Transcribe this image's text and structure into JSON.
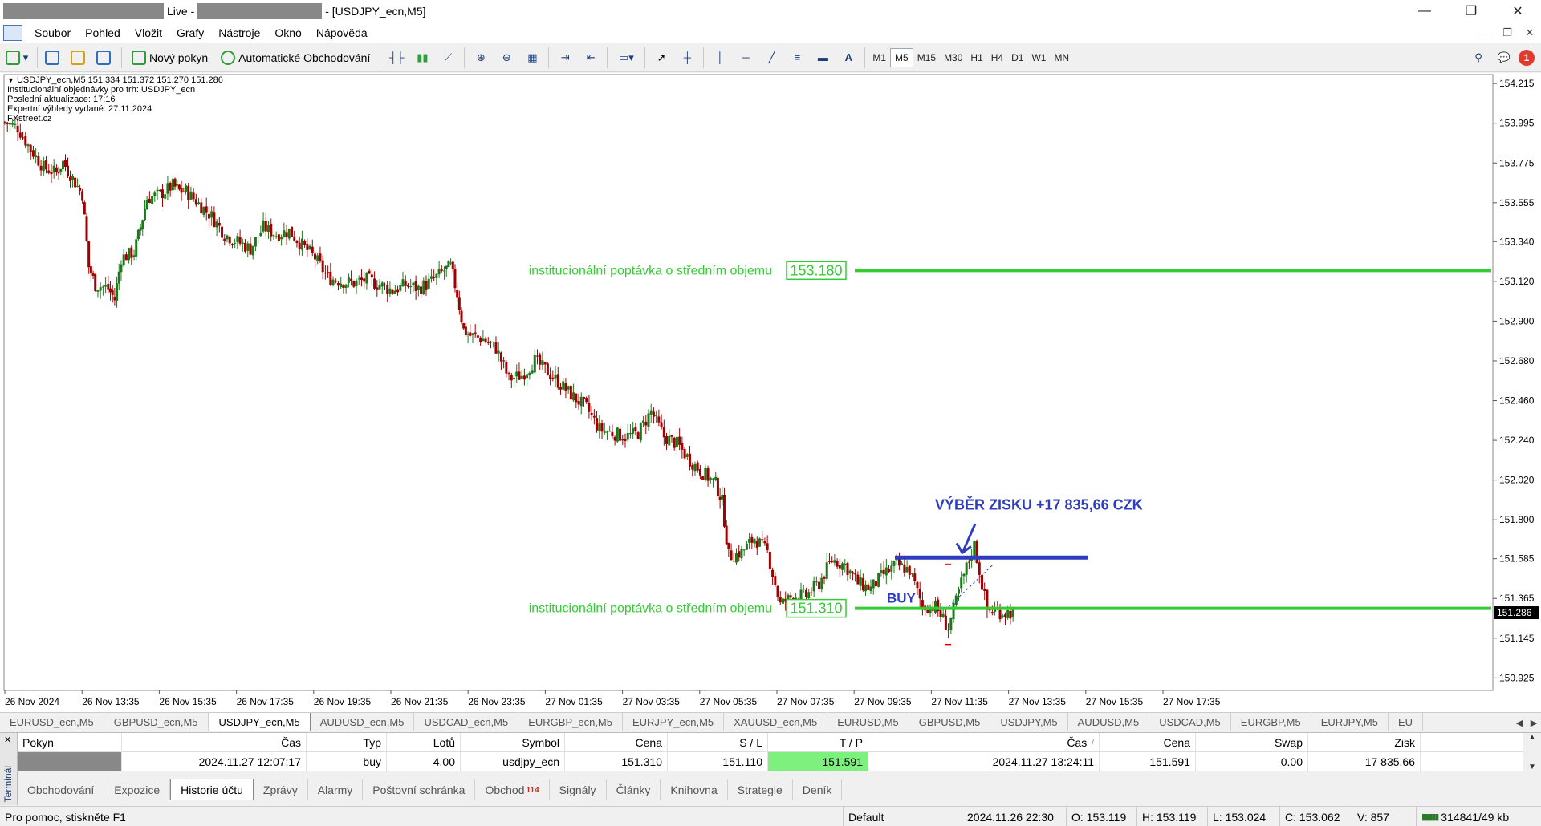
{
  "title": {
    "live": "Live -",
    "tail": "- [USDJPY_ecn,M5]"
  },
  "window_controls": {
    "min": "—",
    "max": "❐",
    "close": "✕"
  },
  "menu": [
    "Soubor",
    "Pohled",
    "Vložit",
    "Grafy",
    "Nástroje",
    "Okno",
    "Nápověda"
  ],
  "toolbar": {
    "new_order": "Nový pokyn",
    "auto_trading": "Automatické Obchodování",
    "timeframes": [
      "M1",
      "M5",
      "M15",
      "M30",
      "H1",
      "H4",
      "D1",
      "W1",
      "MN"
    ],
    "active_timeframe": "M5",
    "notification_count": "1"
  },
  "chart": {
    "header_line": "USDJPY_ecn,M5  151.334 151.372 151.270 151.286",
    "info_lines": [
      "Institucionální objednávky pro trh: USDJPY_ecn",
      "Poslední aktualizace: 17:16",
      "Expertní výhledy vydané: 27.11.2024",
      "FXstreet.cz"
    ],
    "level_label_upper": "institucionální poptávka o středním objemu",
    "level_value_upper": "153.180",
    "level_label_lower": "institucionální poptávka o středním objemu",
    "level_value_lower": "151.310",
    "annotation_profit": "VÝBĚR ZISKU +17 835,66 CZK",
    "annotation_buy": "BUY",
    "current_price": "151.286",
    "colors": {
      "level": "#33cc33",
      "annotation": "#2e3dbf",
      "bull": "#1a7a1a",
      "bear": "#a00000",
      "tp_cell": "#7ef07e"
    }
  },
  "chart_data": {
    "type": "candlestick",
    "title": "",
    "symbol": "USDJPY_ecn",
    "timeframe": "M5",
    "x_tick_labels": [
      "26 Nov 2024",
      "26 Nov 13:35",
      "26 Nov 15:35",
      "26 Nov 17:35",
      "26 Nov 19:35",
      "26 Nov 21:35",
      "26 Nov 23:35",
      "27 Nov 01:35",
      "27 Nov 03:35",
      "27 Nov 05:35",
      "27 Nov 07:35",
      "27 Nov 09:35",
      "27 Nov 11:35",
      "27 Nov 13:35",
      "27 Nov 15:35",
      "27 Nov 17:35"
    ],
    "y_tick_labels": [
      "154.215",
      "153.995",
      "153.775",
      "153.555",
      "153.340",
      "153.120",
      "152.900",
      "152.680",
      "152.460",
      "152.240",
      "152.020",
      "151.800",
      "151.585",
      "151.365",
      "151.145",
      "150.925"
    ],
    "ylim": [
      150.86,
      154.26
    ],
    "price_path": [
      [
        0,
        154.0
      ],
      [
        2,
        153.97
      ],
      [
        4,
        153.85
      ],
      [
        6,
        153.75
      ],
      [
        8,
        153.72
      ],
      [
        9,
        153.78
      ],
      [
        12,
        153.6
      ],
      [
        13,
        153.2
      ],
      [
        14,
        153.1
      ],
      [
        16,
        153.08
      ],
      [
        17,
        153.02
      ],
      [
        18,
        153.25
      ],
      [
        20,
        153.28
      ],
      [
        21,
        153.42
      ],
      [
        22,
        153.58
      ],
      [
        24,
        153.6
      ],
      [
        26,
        153.65
      ],
      [
        27,
        153.62
      ],
      [
        28,
        153.62
      ],
      [
        30,
        153.55
      ],
      [
        32,
        153.48
      ],
      [
        34,
        153.38
      ],
      [
        36,
        153.34
      ],
      [
        38,
        153.3
      ],
      [
        40,
        153.42
      ],
      [
        42,
        153.38
      ],
      [
        44,
        153.4
      ],
      [
        46,
        153.32
      ],
      [
        48,
        153.25
      ],
      [
        50,
        153.14
      ],
      [
        52,
        153.12
      ],
      [
        54,
        153.11
      ],
      [
        56,
        153.13
      ],
      [
        58,
        153.1
      ],
      [
        60,
        153.07
      ],
      [
        62,
        153.1
      ],
      [
        64,
        153.08
      ],
      [
        66,
        153.12
      ],
      [
        68,
        153.18
      ],
      [
        69,
        153.2
      ],
      [
        70,
        153.05
      ],
      [
        71,
        152.85
      ],
      [
        72,
        152.82
      ],
      [
        74,
        152.8
      ],
      [
        76,
        152.75
      ],
      [
        78,
        152.58
      ],
      [
        80,
        152.6
      ],
      [
        82,
        152.68
      ],
      [
        84,
        152.62
      ],
      [
        86,
        152.55
      ],
      [
        88,
        152.48
      ],
      [
        90,
        152.42
      ],
      [
        92,
        152.3
      ],
      [
        94,
        152.28
      ],
      [
        96,
        152.26
      ],
      [
        98,
        152.28
      ],
      [
        100,
        152.4
      ],
      [
        102,
        152.26
      ],
      [
        104,
        152.22
      ],
      [
        106,
        152.13
      ],
      [
        108,
        152.06
      ],
      [
        110,
        152.0
      ],
      [
        111,
        151.9
      ],
      [
        112,
        151.6
      ],
      [
        114,
        151.62
      ],
      [
        116,
        151.7
      ],
      [
        118,
        151.62
      ],
      [
        120,
        151.33
      ],
      [
        122,
        151.38
      ],
      [
        124,
        151.38
      ],
      [
        126,
        151.45
      ],
      [
        128,
        151.58
      ],
      [
        130,
        151.55
      ],
      [
        132,
        151.45
      ],
      [
        134,
        151.42
      ],
      [
        136,
        151.5
      ],
      [
        138,
        151.55
      ],
      [
        140,
        151.52
      ],
      [
        142,
        151.32
      ],
      [
        144,
        151.32
      ],
      [
        146,
        151.2
      ],
      [
        148,
        151.45
      ],
      [
        150,
        151.66
      ],
      [
        152,
        151.3
      ],
      [
        154,
        151.29
      ],
      [
        156,
        151.286
      ]
    ],
    "levels": [
      {
        "label": "institucionální poptávka o středním objemu",
        "price": 153.18
      },
      {
        "label": "institucionální poptávka o středním objemu",
        "price": 151.31
      },
      {
        "label": "VÝBĚR ZISKU +17 835,66 CZK",
        "price": 151.591
      },
      {
        "label": "BUY",
        "price": 151.31
      }
    ],
    "last_price": 151.286,
    "grid": false
  },
  "chart_tabs": [
    "EURUSD_ecn,M5",
    "GBPUSD_ecn,M5",
    "USDJPY_ecn,M5",
    "AUDUSD_ecn,M5",
    "USDCAD_ecn,M5",
    "EURGBP_ecn,M5",
    "EURJPY_ecn,M5",
    "XAUUSD_ecn,M5",
    "EURUSD,M5",
    "GBPUSD,M5",
    "USDJPY,M5",
    "AUDUSD,M5",
    "USDCAD,M5",
    "EURGBP,M5",
    "EURJPY,M5",
    "EU"
  ],
  "active_chart_tab": "USDJPY_ecn,M5",
  "terminal": {
    "side_label": "Terminál",
    "columns": [
      "Pokyn",
      "Čas",
      "Typ",
      "Lotů",
      "Symbol",
      "Cena",
      "S / L",
      "T / P",
      "Čas",
      "Cena",
      "Swap",
      "Zisk"
    ],
    "sort_indicator": "/",
    "row": {
      "time_open": "2024.11.27 12:07:17",
      "type": "buy",
      "lots": "4.00",
      "symbol": "usdjpy_ecn",
      "price_open": "151.310",
      "sl": "151.110",
      "tp": "151.591",
      "time_close": "2024.11.27 13:24:11",
      "price_close": "151.591",
      "swap": "0.00",
      "profit": "17 835.66"
    },
    "tabs": [
      "Obchodování",
      "Expozice",
      "Historie účtu",
      "Zprávy",
      "Alarmy",
      "Poštovní schránka",
      "Obchod",
      "Signály",
      "Články",
      "Knihovna",
      "Strategie",
      "Deník"
    ],
    "active_tab": "Historie účtu",
    "trade_badge": "114"
  },
  "statusbar": {
    "help": "Pro pomoc, stiskněte F1",
    "profile": "Default",
    "datetime": "2024.11.26 22:30",
    "open": "O: 153.119",
    "high": "H: 153.119",
    "low": "L: 153.024",
    "close": "C: 153.062",
    "volume": "V: 857",
    "traffic": "314841/49 kb"
  }
}
